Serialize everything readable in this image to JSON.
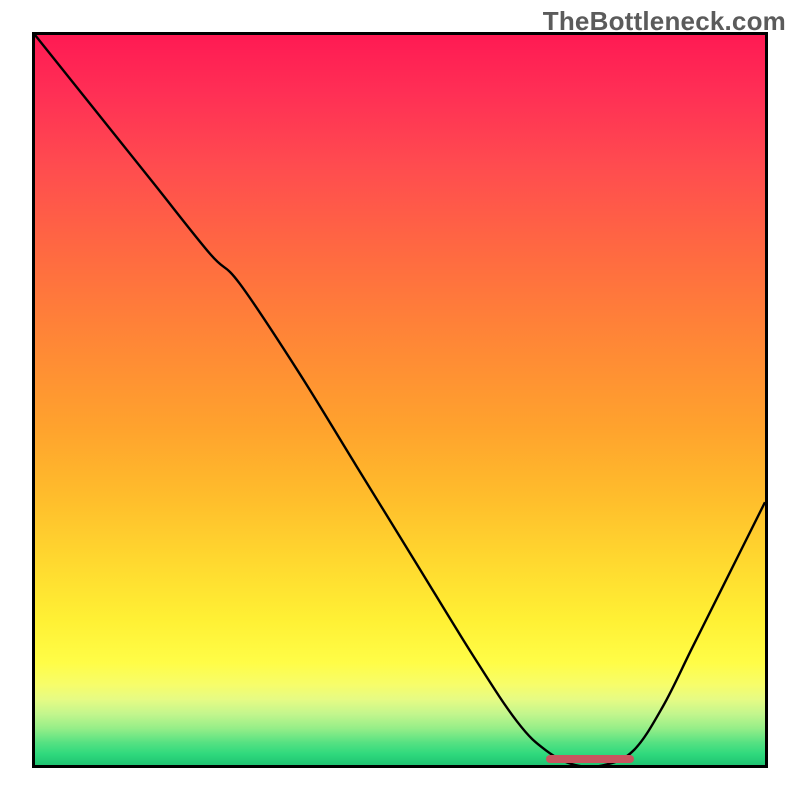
{
  "watermark": "TheBottleneck.com",
  "chart_data": {
    "type": "line",
    "title": "",
    "xlabel": "",
    "ylabel": "",
    "xlim": [
      0,
      100
    ],
    "ylim": [
      0,
      100
    ],
    "grid": false,
    "series": [
      {
        "name": "bottleneck-curve",
        "x": [
          0,
          8,
          16,
          24,
          28,
          36,
          44,
          52,
          60,
          66,
          70,
          74,
          78,
          82,
          86,
          90,
          94,
          100
        ],
        "y": [
          100,
          90,
          80,
          70,
          66,
          54,
          41,
          28,
          15,
          6,
          2,
          0,
          0,
          2,
          8,
          16,
          24,
          36
        ]
      }
    ],
    "annotations": [
      {
        "name": "optimal-range-marker",
        "x0": 70,
        "x1": 82,
        "y": 0
      }
    ]
  }
}
